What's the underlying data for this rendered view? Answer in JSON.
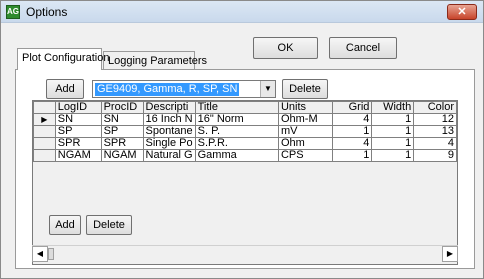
{
  "window": {
    "title": "Options",
    "icon_text": "AG",
    "close_glyph": "✕"
  },
  "buttons": {
    "ok": "OK",
    "cancel": "Cancel",
    "add_top": "Add",
    "delete_top": "Delete",
    "add_bottom": "Add",
    "delete_bottom": "Delete"
  },
  "tabs": [
    {
      "label": "Plot Configuration",
      "active": true
    },
    {
      "label": "Logging Parameters",
      "active": false
    }
  ],
  "combo": {
    "value": "GE9409, Gamma, R, SP, SN"
  },
  "grid": {
    "columns": [
      "LogID",
      "ProcID",
      "Descripti",
      "Title",
      "Units",
      "Grid",
      "Width",
      "Color"
    ],
    "rows": [
      [
        "SN",
        "SN",
        "16 Inch N",
        "16\" Norm",
        "Ohm-M",
        "4",
        "1",
        "12"
      ],
      [
        "SP",
        "SP",
        "Spontane",
        "S. P.",
        "mV",
        "1",
        "1",
        "13"
      ],
      [
        "SPR",
        "SPR",
        "Single Po",
        "S.P.R.",
        "Ohm",
        "4",
        "1",
        "4"
      ],
      [
        "NGAM",
        "NGAM",
        "Natural G",
        "Gamma",
        "CPS",
        "1",
        "1",
        "9"
      ]
    ],
    "current_row_marker": "▶"
  },
  "scroll": {
    "left_arrow": "◀",
    "right_arrow": "▶"
  },
  "icons": {
    "dropdown": "▼"
  }
}
